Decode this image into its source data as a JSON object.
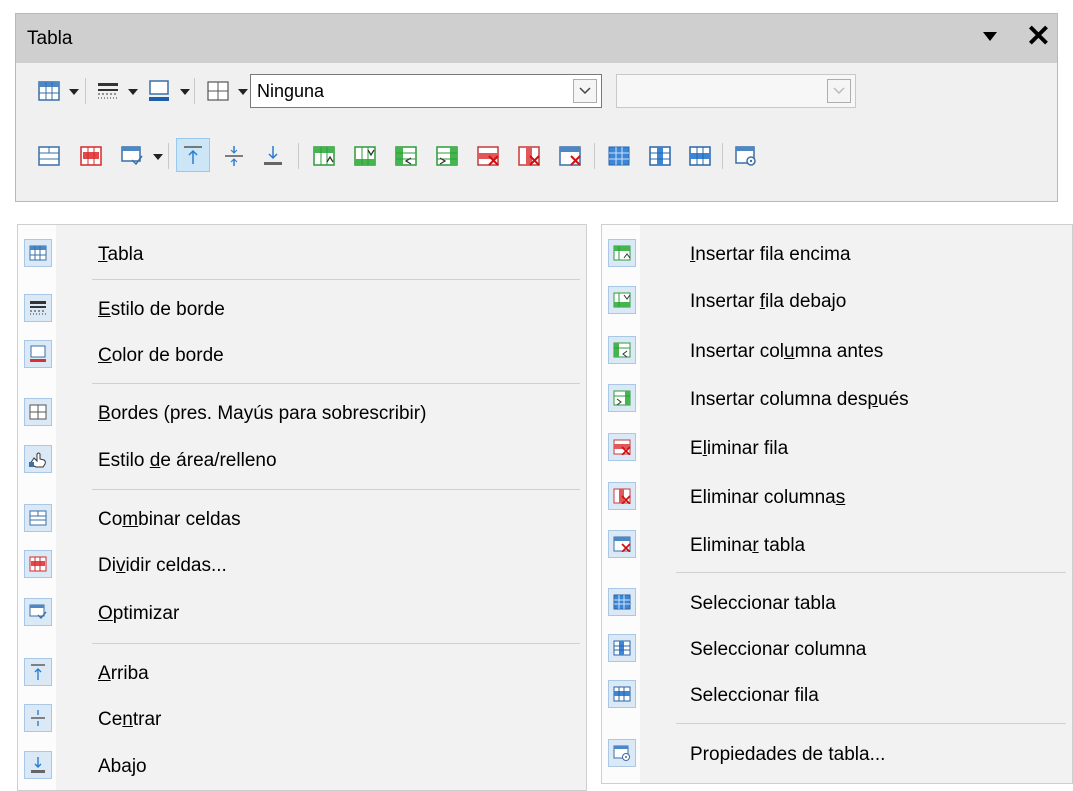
{
  "toolbar": {
    "title": "Tabla",
    "combo_value": "Ninguna",
    "combo2_value": ""
  },
  "left_menu": [
    {
      "pre": "",
      "u": "T",
      "post": "abla",
      "icon": "table-icon"
    },
    {
      "pre": "",
      "u": "E",
      "post": "stilo de borde",
      "icon": "border-style-icon"
    },
    {
      "pre": "",
      "u": "C",
      "post": "olor de borde",
      "icon": "border-color-icon"
    },
    {
      "pre": "",
      "u": "B",
      "post": "ordes (pres. Mayús para sobrescribir)",
      "icon": "borders-icon"
    },
    {
      "pre": "Estilo ",
      "u": "d",
      "post": "e área/relleno",
      "icon": "area-fill-icon"
    },
    {
      "pre": "Co",
      "u": "m",
      "post": "binar celdas",
      "icon": "merge-cells-icon"
    },
    {
      "pre": "Di",
      "u": "v",
      "post": "idir celdas...",
      "icon": "split-cells-icon"
    },
    {
      "pre": "",
      "u": "O",
      "post": "ptimizar",
      "icon": "optimize-icon"
    },
    {
      "pre": "",
      "u": "A",
      "post": "rriba",
      "icon": "align-top-icon"
    },
    {
      "pre": "Ce",
      "u": "n",
      "post": "trar",
      "icon": "align-center-icon"
    },
    {
      "pre": "Aba",
      "u": "j",
      "post": "o",
      "icon": "align-bottom-icon"
    }
  ],
  "right_menu": [
    {
      "pre": "",
      "u": "I",
      "post": "nsertar fila encima",
      "icon": "insert-row-above-icon"
    },
    {
      "pre": "Insertar ",
      "u": "f",
      "post": "ila debajo",
      "icon": "insert-row-below-icon"
    },
    {
      "pre": "Insertar col",
      "u": "u",
      "post": "mna antes",
      "icon": "insert-column-before-icon"
    },
    {
      "pre": "Insertar columna des",
      "u": "p",
      "post": "ués",
      "icon": "insert-column-after-icon"
    },
    {
      "pre": "E",
      "u": "l",
      "post": "iminar fila",
      "icon": "delete-row-icon"
    },
    {
      "pre": "Eliminar columna",
      "u": "s",
      "post": "",
      "icon": "delete-column-icon"
    },
    {
      "pre": "Elimina",
      "u": "r",
      "post": " tabla",
      "icon": "delete-table-icon"
    },
    {
      "pre": "Seleccionar tabla",
      "u": "",
      "post": "",
      "icon": "select-table-icon"
    },
    {
      "pre": "Seleccionar columna",
      "u": "",
      "post": "",
      "icon": "select-column-icon"
    },
    {
      "pre": "Seleccionar fila",
      "u": "",
      "post": "",
      "icon": "select-row-icon"
    },
    {
      "pre": "Propiedades de tabla...",
      "u": "",
      "post": "",
      "icon": "table-properties-icon"
    }
  ]
}
